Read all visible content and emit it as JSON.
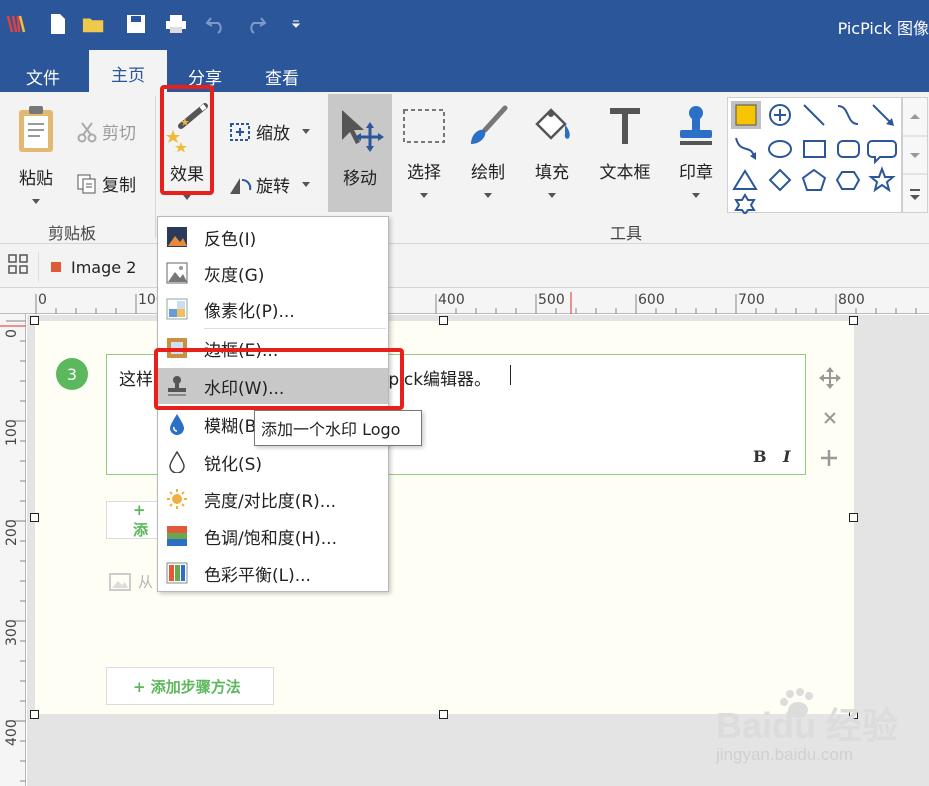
{
  "app": {
    "title": "PicPick 图像"
  },
  "menu_tabs": [
    {
      "label": "文件"
    },
    {
      "label": "主页",
      "active": true
    },
    {
      "label": "分享"
    },
    {
      "label": "查看"
    }
  ],
  "ribbon": {
    "paste_label": "粘贴",
    "cut_label": "剪切",
    "copy_label": "复制",
    "clipboard_group": "剪贴板",
    "effects_label": "效果",
    "resize_label": "缩放",
    "rotate_label": "旋转",
    "move_label": "移动",
    "select_label": "选择",
    "draw_label": "绘制",
    "fill_label": "填充",
    "textbox_label": "文本框",
    "stamp_label": "印章",
    "tools_group": "工具"
  },
  "doc_tab": {
    "label": "Image 2"
  },
  "ruler": {
    "h": [
      "0",
      "100",
      "400",
      "500",
      "600",
      "700",
      "800"
    ],
    "v": [
      "0",
      "100",
      "200",
      "300",
      "400"
    ]
  },
  "effects_menu": {
    "items": [
      {
        "label": "反色(I)"
      },
      {
        "label": "灰度(G)"
      },
      {
        "label": "像素化(P)..."
      },
      {
        "label": "边框(E)..."
      },
      {
        "label": "水印(W)..."
      },
      {
        "label": "模糊(B)"
      },
      {
        "label": "锐化(S)"
      },
      {
        "label": "亮度/对比度(R)..."
      },
      {
        "label": "色调/饱和度(H)..."
      },
      {
        "label": "色彩平衡(L)..."
      }
    ],
    "tooltip": "添加一个水印 Logo"
  },
  "editor": {
    "step_number": "3",
    "text_left": "这样",
    "text_right": "cpick编辑器。",
    "bold_label": "B",
    "italic_label": "I",
    "add_step_label": "+ 添加步骤方法",
    "add_partial_label": "+ 添",
    "from_label": "从"
  },
  "watermark": {
    "brand": "Baidu 经验",
    "url": "jingyan.baidu.com"
  },
  "colors": {
    "titlebar": "#2b579a",
    "ribbon": "#f3f3f3",
    "highlight_red": "#e8201c",
    "step_green": "#5cb85c"
  }
}
